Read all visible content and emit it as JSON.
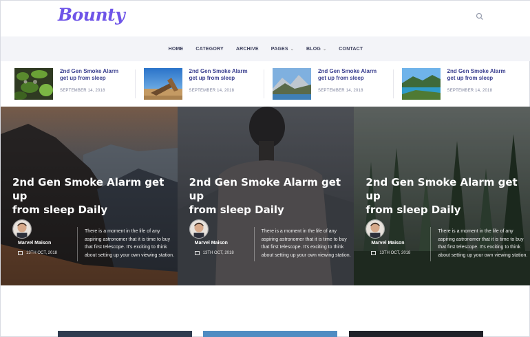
{
  "logo": "Bounty",
  "nav": [
    {
      "label": "HOME",
      "dropdown": false
    },
    {
      "label": "CATEGORY",
      "dropdown": false
    },
    {
      "label": "ARCHIVE",
      "dropdown": false
    },
    {
      "label": "PAGES",
      "dropdown": true
    },
    {
      "label": "BLOG",
      "dropdown": true
    },
    {
      "label": "CONTACT",
      "dropdown": false
    }
  ],
  "strip": [
    {
      "title": "2nd Gen Smoke Alarm get up from sleep",
      "date": "SEPTEMBER 14, 2018"
    },
    {
      "title": "2nd Gen Smoke Alarm get up from sleep",
      "date": "SEPTEMBER 14, 2018"
    },
    {
      "title": "2nd Gen Smoke Alarm get up from sleep",
      "date": "SEPTEMBER 14, 2018"
    },
    {
      "title": "2nd Gen Smoke Alarm get up from sleep",
      "date": "SEPTEMBER 14, 2018"
    }
  ],
  "cards": [
    {
      "title_l1": "2nd Gen Smoke Alarm get",
      "title_l2": "up",
      "title_l3": "from sleep Daily",
      "author": "Marvel Maison",
      "date": "13TH OCT, 2018",
      "excerpt": "There is a moment in the life of any aspiring astronomer that it is time to buy that first telescope. It's exciting to think about setting up your own viewing station."
    },
    {
      "title_l1": "2nd Gen Smoke Alarm get",
      "title_l2": "up",
      "title_l3": "from sleep Daily",
      "author": "Marvel Maison",
      "date": "13TH OCT, 2018",
      "excerpt": "There is a moment in the life of any aspiring astronomer that it is time to buy that first telescope. It's exciting to think about setting up your own viewing station."
    },
    {
      "title_l1": "2nd Gen Smoke Alarm get",
      "title_l2": "up",
      "title_l3": "from sleep Daily",
      "author": "Marvel Maison",
      "date": "13TH OCT, 2018",
      "excerpt": "There is a moment in the life of any aspiring astronomer that it is time to buy that first telescope. It's exciting to think about setting up your own viewing station."
    }
  ],
  "icons": {
    "search": "search-icon",
    "calendar": "calendar-icon",
    "chevron": "chevron-down-icon"
  },
  "colors": {
    "brand": "#6e54e8",
    "nav_bg": "#f3f4f8",
    "link": "#3a3f8f"
  }
}
